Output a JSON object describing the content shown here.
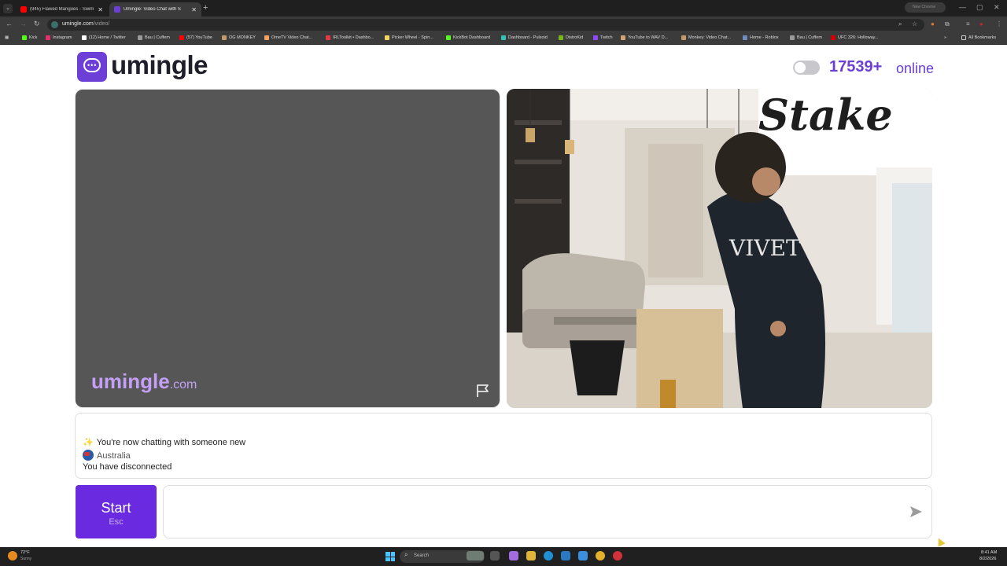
{
  "browser": {
    "tabs": [
      {
        "title": "(945) Flawed Mangoes - Swim",
        "favicon_color": "#ff0000",
        "active": false
      },
      {
        "title": "Umingle: Video Chat with S",
        "favicon_color": "#6c3fd6",
        "active": true
      }
    ],
    "address": {
      "domain": "umingle.com",
      "path": "/video/"
    },
    "profile_label": "New Chrome",
    "bookmarks": [
      {
        "label": "Kick",
        "color": "#53fc18"
      },
      {
        "label": "Instagram",
        "color": "#e1306c"
      },
      {
        "label": "(12) Home / Twitter",
        "color": "#ffffff"
      },
      {
        "label": "Bau | Cuffem",
        "color": "#999999"
      },
      {
        "label": "(57) YouTube",
        "color": "#ff0000"
      },
      {
        "label": "OG MONKEY",
        "color": "#c49a6c"
      },
      {
        "label": "OmeTV Video Chat...",
        "color": "#f4a261"
      },
      {
        "label": "IRLToolkit • Dashbo...",
        "color": "#e63946"
      },
      {
        "label": "Picker Wheel - Spin...",
        "color": "#f4d35e"
      },
      {
        "label": "KickBot Dashboard",
        "color": "#53fc18"
      },
      {
        "label": "Dashboard - Pulsoid",
        "color": "#2ec4b6"
      },
      {
        "label": "DistroKid",
        "color": "#7cb518"
      },
      {
        "label": "Twitch",
        "color": "#9146ff"
      },
      {
        "label": "YouTube to WAV D...",
        "color": "#d4a373"
      },
      {
        "label": "Monkey: Video Chat...",
        "color": "#c49a6c"
      },
      {
        "label": "Home - Roblox",
        "color": "#6c8ebf"
      },
      {
        "label": "Bau | Cuffem",
        "color": "#999999"
      },
      {
        "label": "UFC 326: Holloway...",
        "color": "#d00000"
      }
    ],
    "all_bookmarks_label": "All Bookmarks"
  },
  "header": {
    "brand": "umingle",
    "online_count": "17539+",
    "online_label": "online",
    "accent_color": "#6b3fd4"
  },
  "video": {
    "watermark_brand": "umingle",
    "watermark_tld": ".com"
  },
  "chat": {
    "messages": [
      {
        "text": "You're now chatting with someone new",
        "icon": "sparkles-icon"
      },
      {
        "text": "Australia",
        "icon": "globe-icon"
      },
      {
        "text": "You have disconnected",
        "icon": ""
      }
    ],
    "input_value": "",
    "input_placeholder": ""
  },
  "controls": {
    "start_label": "Start",
    "start_hint": "Esc",
    "start_color": "#6a2ae0"
  },
  "taskbar": {
    "weather_temp": "72°F",
    "weather_condition": "Sunny",
    "search_label": "Search",
    "time": "8:41 AM",
    "date": "8/2/2026"
  }
}
